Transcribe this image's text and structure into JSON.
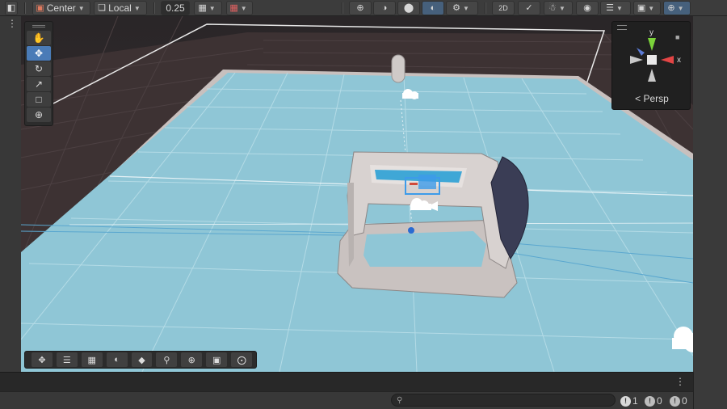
{
  "toolbar": {
    "pivot_label": "Center",
    "space_label": "Local",
    "snap_value": "0.25"
  },
  "tools": [
    "hand-tool",
    "move-tool",
    "rotate-tool",
    "scale-tool",
    "rect-tool",
    "transform-tool"
  ],
  "gizmo": {
    "y_label": "y",
    "x_label": "x",
    "projection_label": "< Persp"
  },
  "status": {
    "search_placeholder": "",
    "log_count": "1",
    "warning_count": "0",
    "error_count": "0"
  },
  "colors": {
    "ground": "#8fc6d6",
    "grid_line": "#b4dbe6",
    "selection_blue": "#3d9be9",
    "axis_x": "#e34545",
    "axis_y": "#7bd33a",
    "toolbar_bg": "#3c3c3c"
  }
}
